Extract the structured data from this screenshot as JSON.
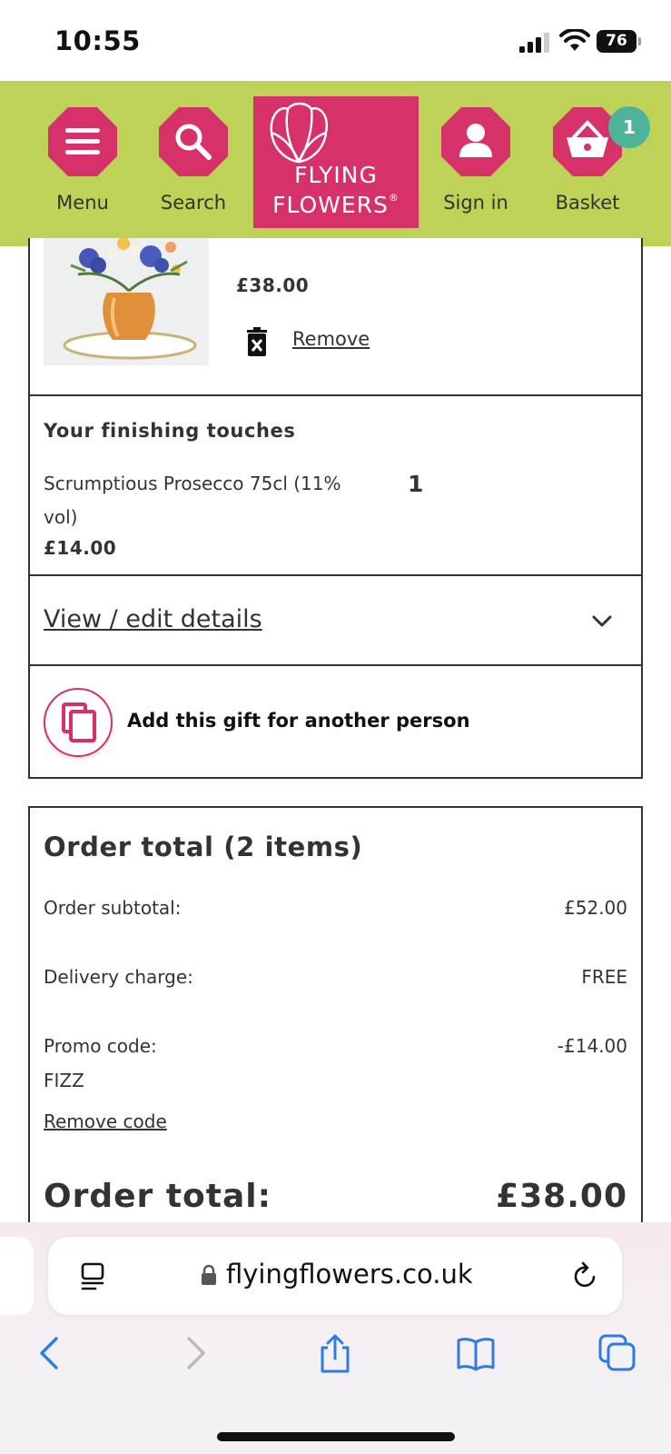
{
  "status_bar": {
    "time": "10:55",
    "battery": "76"
  },
  "header": {
    "menu_label": "Menu",
    "search_label": "Search",
    "logo_line1": "FLYING",
    "logo_line2": "FLOWERS",
    "logo_mark": "®",
    "signin_label": "Sign in",
    "basket_label": "Basket",
    "basket_count": "1",
    "colors": {
      "bar": "#bdd257",
      "brand": "#d63169",
      "badge": "#4db39b"
    }
  },
  "product": {
    "price": "£38.00",
    "remove_label": "Remove"
  },
  "finishing_touches": {
    "title": "Your finishing touches",
    "item_name": "Scrumptious Prosecco 75cl (11% vol)",
    "quantity": "1",
    "price": "£14.00"
  },
  "details": {
    "link_label": "View / edit details"
  },
  "add_gift": {
    "label": "Add this gift for another person"
  },
  "order": {
    "title": "Order total (2 items)",
    "subtotal_label": "Order subtotal:",
    "subtotal_value": "£52.00",
    "delivery_label": "Delivery charge:",
    "delivery_value": "FREE",
    "promo_label": "Promo code:",
    "promo_code": "FIZZ",
    "promo_value": "-£14.00",
    "remove_code_label": "Remove code",
    "total_label": "Order total:",
    "total_value": "£38.00"
  },
  "browser": {
    "url": "flyingflowers.co.uk",
    "toolbar_icons": [
      "back-icon",
      "forward-icon",
      "share-icon",
      "bookmarks-icon",
      "tabs-icon"
    ]
  }
}
